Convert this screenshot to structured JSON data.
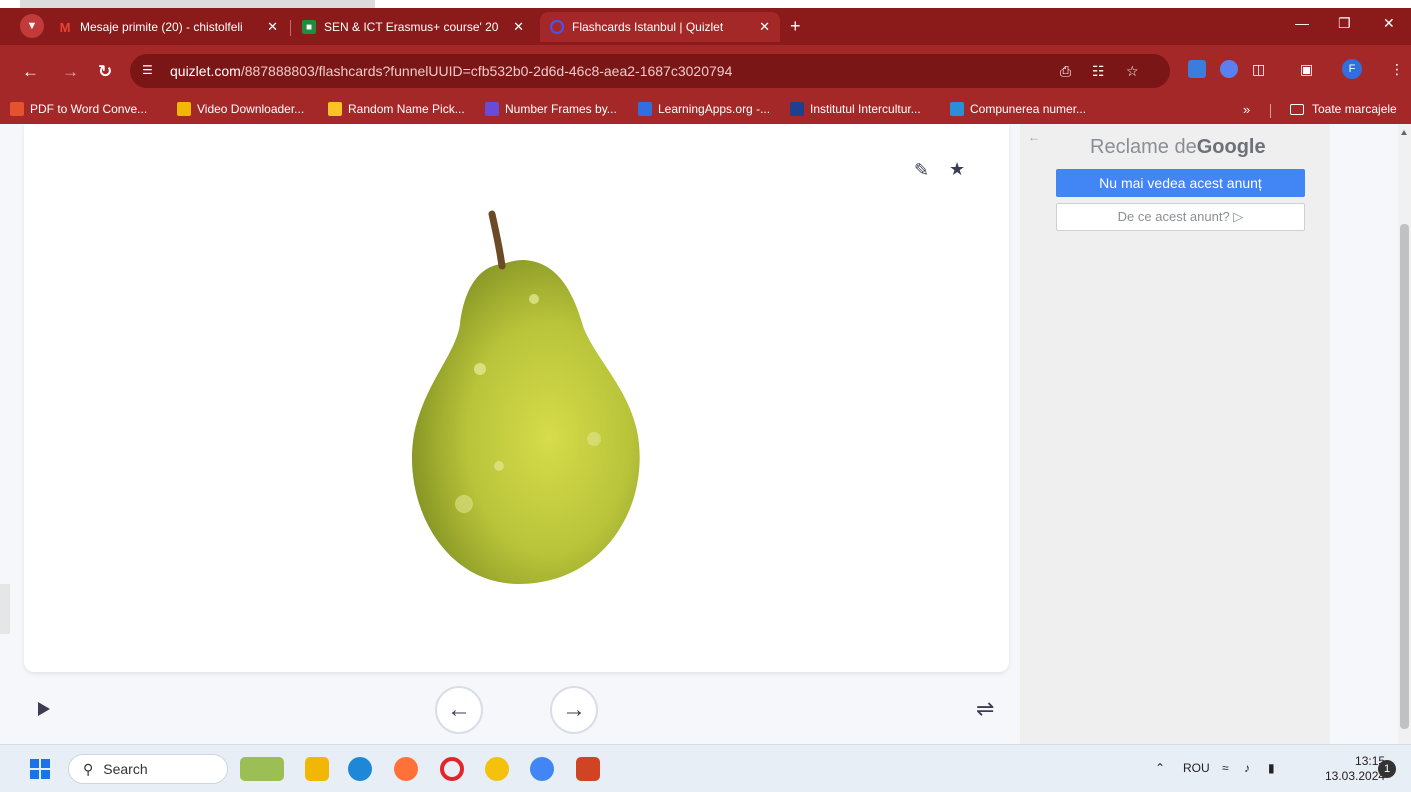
{
  "browser": {
    "tabs": [
      {
        "label": "Mesaje primite (20) - chistolfeli",
        "favicon": "gmail-icon",
        "active": false
      },
      {
        "label": "SEN & ICT Erasmus+ course' 20",
        "favicon": "classroom-icon",
        "active": false
      },
      {
        "label": "Flashcards Istanbul | Quizlet",
        "favicon": "quizlet-icon",
        "active": true
      }
    ],
    "close_glyph": "✕",
    "new_tab_glyph": "+",
    "address": {
      "host": "quizlet.com",
      "path": "/887888803/flashcards?funnelUUID=cfb532b0-2d6d-46c8-aea2-1687c3020794"
    },
    "profile_initial": "F",
    "bookmarks": [
      {
        "label": "PDF to Word Conve...",
        "color": "#e5532d"
      },
      {
        "label": "Video Downloader...",
        "color": "#f2b705"
      },
      {
        "label": "Random Name Pick...",
        "color": "#f7c325"
      },
      {
        "label": "Number Frames by...",
        "color": "#6a4bd8"
      },
      {
        "label": "LearningApps.org -...",
        "color": "#2f6fe0"
      },
      {
        "label": "Institutul Intercultur...",
        "color": "#1f3f8f"
      },
      {
        "label": "Compunerea numer...",
        "color": "#2a8fd6"
      }
    ],
    "bookmarks_more": "»",
    "bookmarks_folder": "Toate marcajele"
  },
  "flashcard": {
    "image_subject": "pear",
    "edit_icon": "pencil-icon",
    "star_icon": "star-icon"
  },
  "ad": {
    "back_glyph": "←",
    "title_prefix": "Reclame de",
    "title_brand": "Google",
    "stop_button": "Nu mai vedea acest anunț",
    "why_button": "De ce acest anunt? ▷"
  },
  "taskbar": {
    "search_label": "Search",
    "language": "ROU",
    "time": "13:15",
    "date": "13.03.2024",
    "notification_count": "1"
  },
  "colors": {
    "browser_frame": "#a52828",
    "tab_strip": "#8b1a1a",
    "ad_button": "#4285f4"
  }
}
